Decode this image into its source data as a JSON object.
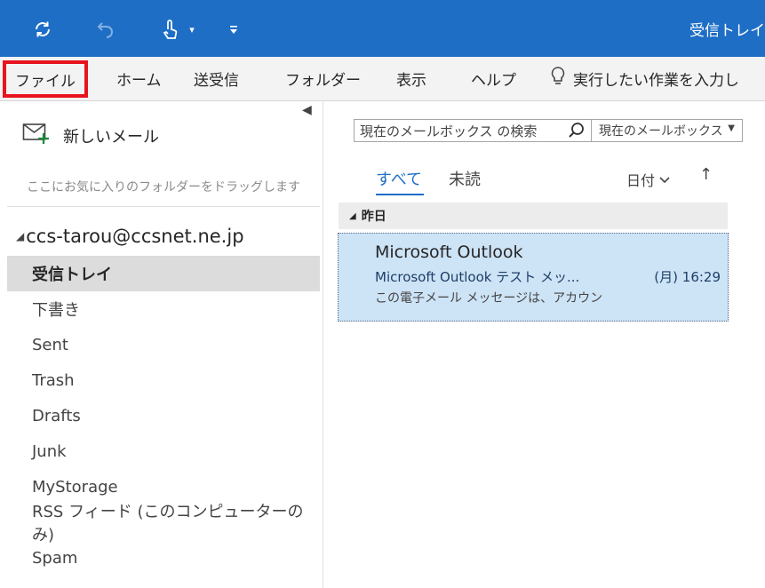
{
  "titlebar": {
    "title": "受信トレイ",
    "bg_color": "#1e6ec6",
    "icons": [
      "sync-icon",
      "undo-icon",
      "touch-mode-icon",
      "dropdown-arrow-icon",
      "customize-toolbar-icon"
    ]
  },
  "ribbon": {
    "tabs": [
      "ファイル",
      "ホーム",
      "送受信",
      "フォルダー",
      "表示",
      "ヘルプ"
    ],
    "tell_me": "実行したい作業を入力し",
    "highlight_color": "#e8141e"
  },
  "left": {
    "new_mail": "新しいメール",
    "favorites_hint": "ここにお気に入りのフォルダーをドラッグします",
    "account": "ccs-tarou@ccsnet.ne.jp",
    "folders": [
      "受信トレイ",
      "下書き",
      "Sent",
      "Trash",
      "Drafts",
      "Junk",
      "MyStorage",
      "RSS フィード (このコンピューターのみ)",
      "Spam"
    ],
    "selected_folder": "受信トレイ"
  },
  "right": {
    "search_placeholder": "現在のメールボックス の検索",
    "scope": "現在のメールボックス",
    "filter_tabs": [
      "すべて",
      "未読"
    ],
    "sort_label": "日付",
    "sort_direction": "↑",
    "group_header": "昨日",
    "messages": [
      {
        "sender": "Microsoft Outlook",
        "subject": "Microsoft Outlook テスト メッ...",
        "time": "(月) 16:29",
        "preview": "この電子メール メッセージは、アカウン"
      }
    ],
    "selection_color": "#cde3f6"
  }
}
